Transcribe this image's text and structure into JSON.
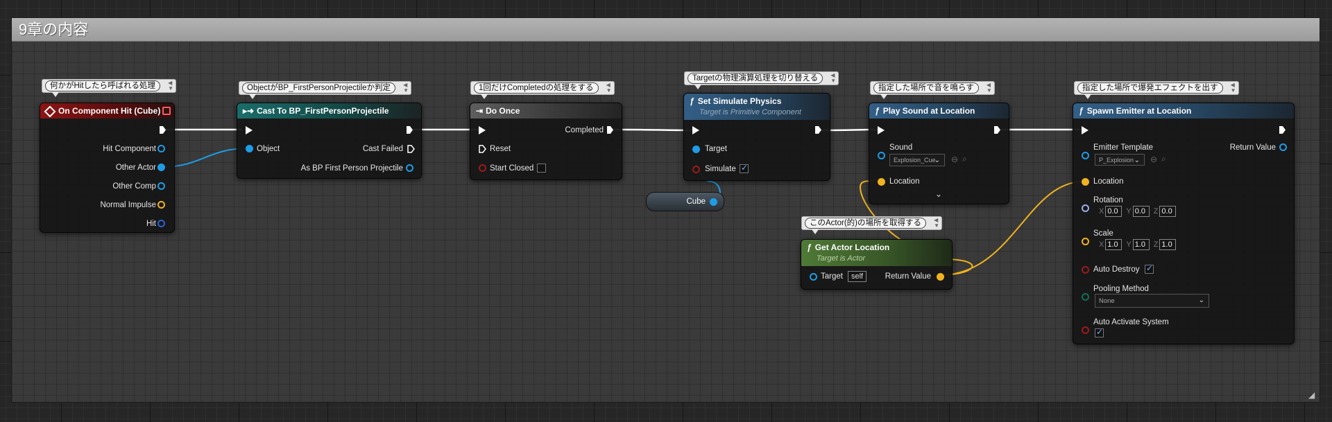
{
  "comment": {
    "title": "9章の内容"
  },
  "nodes": {
    "on_hit": {
      "title": "On Component Hit (Cube)",
      "bubble": "何かがHitしたら呼ばれる処理",
      "pins": [
        "Hit Component",
        "Other Actor",
        "Other Comp",
        "Normal Impulse",
        "Hit"
      ]
    },
    "cast": {
      "title": "Cast To BP_FirstPersonProjectile",
      "bubble": "ObjectがBP_FirstPersonProjectileか判定",
      "in_object": "Object",
      "out_failed": "Cast Failed",
      "out_as": "As BP First Person Projectile"
    },
    "do_once": {
      "title": "Do Once",
      "bubble": "1回だけCompletedの処理をする",
      "out_completed": "Completed",
      "in_reset": "Reset",
      "in_start_closed": "Start Closed"
    },
    "simulate": {
      "title": "Set Simulate Physics",
      "subtitle": "Target is Primitive Component",
      "bubble": "Targetの物理演算処理を切り替える",
      "in_target": "Target",
      "in_simulate": "Simulate",
      "simulate_checked": true
    },
    "cube_var": {
      "label": "Cube"
    },
    "play_sound": {
      "title": "Play Sound at Location",
      "bubble": "指定した場所で音を鳴らす",
      "in_sound": "Sound",
      "sound_value": "Explosion_Cue",
      "in_location": "Location"
    },
    "get_loc": {
      "title": "Get Actor Location",
      "subtitle": "Target is Actor",
      "bubble": "このActor(的)の場所を取得する",
      "in_target": "Target",
      "target_value": "self",
      "out_return": "Return Value"
    },
    "spawn": {
      "title": "Spawn Emitter at Location",
      "bubble": "指定した場所で爆発エフェクトを出す",
      "in_template": "Emitter Template",
      "template_value": "P_Explosion",
      "out_return": "Return Value",
      "in_location": "Location",
      "in_rotation": "Rotation",
      "rotation": {
        "x": "0.0",
        "y": "0.0",
        "z": "0.0"
      },
      "in_scale": "Scale",
      "scale": {
        "x": "1.0",
        "y": "1.0",
        "z": "1.0"
      },
      "axis_x": "X",
      "axis_y": "Y",
      "axis_z": "Z",
      "in_auto_destroy": "Auto Destroy",
      "auto_destroy_checked": true,
      "in_pooling": "Pooling Method",
      "pooling_value": "None",
      "in_auto_activate": "Auto Activate System",
      "auto_activate_checked": true
    }
  },
  "colors": {
    "exec_wire": "#ffffff",
    "object_pin": "#1f9ce6",
    "struct_pin": "#f0b31f",
    "bool_pin": "#9c1a1a",
    "rotator_pin": "#9aaee8",
    "enum_pin": "#136f55"
  },
  "icons": [
    "event-icon",
    "cast-icon",
    "do-once-icon",
    "function-icon",
    "chevron-down-icon",
    "search-icon",
    "browse-icon"
  ]
}
